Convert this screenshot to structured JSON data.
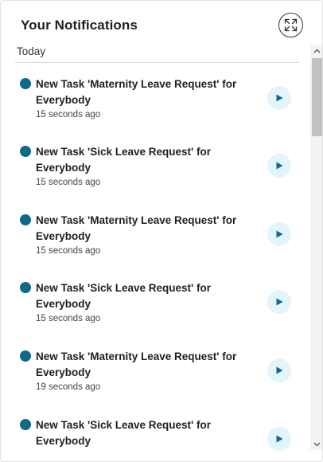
{
  "panel": {
    "title": "Your Notifications",
    "expand_icon": "expand-arrows-icon",
    "section_label": "Today"
  },
  "notifications": [
    {
      "title": "New Task 'Maternity Leave Request' for Everybody",
      "time": "15 seconds ago",
      "icon": "play-icon"
    },
    {
      "title": "New Task 'Sick Leave Request' for Everybody",
      "time": "15 seconds ago",
      "icon": "play-icon"
    },
    {
      "title": "New Task 'Maternity Leave Request' for Everybody",
      "time": "15 seconds ago",
      "icon": "play-icon"
    },
    {
      "title": "New Task 'Sick Leave Request' for Everybody",
      "time": "15 seconds ago",
      "icon": "play-icon"
    },
    {
      "title": "New Task 'Maternity Leave Request' for Everybody",
      "time": "19 seconds ago",
      "icon": "play-icon"
    },
    {
      "title": "New Task 'Sick Leave Request' for Everybody",
      "time": "",
      "icon": "play-icon"
    }
  ],
  "colors": {
    "unread_dot": "#0f6a8a",
    "open_button_bg": "#e3f4fb",
    "open_button_icon": "#0f6a8a"
  }
}
